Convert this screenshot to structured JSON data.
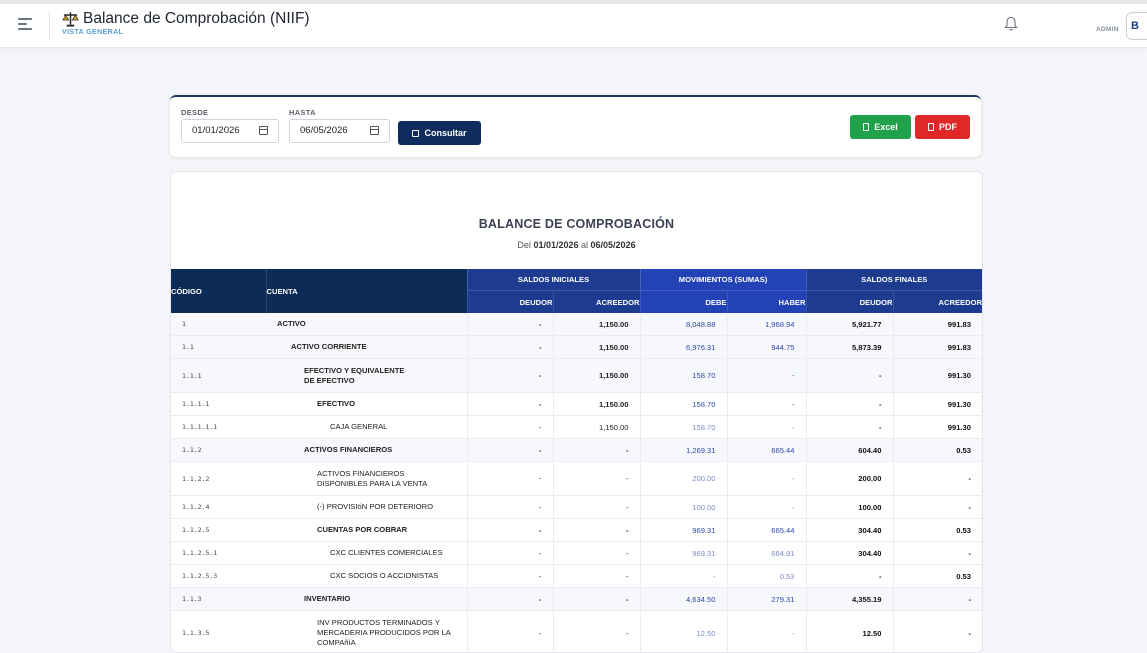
{
  "header": {
    "title": "Balance de Comprobación (NIIF)",
    "subtitle": "VISTA GENERAL",
    "user_role": "ADMIN",
    "avatar_initial": "B"
  },
  "filters": {
    "desde_label": "DESDE",
    "desde_value": "01/01/2026",
    "hasta_label": "HASTA",
    "hasta_value": "06/05/2026",
    "consultar_label": "Consultar",
    "excel_label": "Excel",
    "pdf_label": "PDF"
  },
  "report": {
    "title": "BALANCE DE COMPROBACIÓN",
    "range_prefix": "Del",
    "range_from": "01/01/2026",
    "range_mid": "al",
    "range_to": "06/05/2026",
    "columns": {
      "codigo": "CÓDIGO",
      "cuenta": "CUENTA",
      "saldos_iniciales": "SALDOS INICIALES",
      "movimientos": "MOVIMIENTOS (SUMAS)",
      "saldos_finales": "SALDOS FINALES",
      "deudor": "DEUDOR",
      "acreedor": "ACREEDOR",
      "debe": "DEBE",
      "haber": "HABER"
    },
    "rows": [
      {
        "code": "1",
        "name": "ACTIVO",
        "level": 0,
        "bold": true,
        "si_d": "-",
        "si_a": "1,150.00",
        "debe": "8,048.88",
        "haber": "1,968.94",
        "sf_d": "5,921.77",
        "sf_a": "991.83"
      },
      {
        "code": "1.1",
        "name": "ACTIVO CORRIENTE",
        "level": 1,
        "bold": true,
        "si_d": "-",
        "si_a": "1,150.00",
        "debe": "6,976.31",
        "haber": "944.75",
        "sf_d": "5,873.39",
        "sf_a": "991.83"
      },
      {
        "code": "1.1.1",
        "name": "EFECTIVO Y EQUIVALENTE DE EFECTIVO",
        "level": 2,
        "bold": true,
        "si_d": "-",
        "si_a": "1,150.00",
        "debe": "158.70",
        "haber": "-",
        "sf_d": "-",
        "sf_a": "991.30"
      },
      {
        "code": "1.1.1.1",
        "name": "EFECTIVO",
        "level": 3,
        "bold": true,
        "si_d": "-",
        "si_a": "1,150.00",
        "debe": "158.70",
        "haber": "-",
        "sf_d": "-",
        "sf_a": "991.30"
      },
      {
        "code": "1.1.1.1.1",
        "name": "CAJA GENERAL",
        "level": 4,
        "bold": false,
        "si_d": "-",
        "si_a": "1,150.00",
        "debe": "158.70",
        "haber": "-",
        "sf_d": "-",
        "sf_a": "991.30"
      },
      {
        "code": "1.1.2",
        "name": "ACTIVOS FINANCIEROS",
        "level": 2,
        "bold": true,
        "si_d": "-",
        "si_a": "-",
        "debe": "1,269.31",
        "haber": "665.44",
        "sf_d": "604.40",
        "sf_a": "0.53"
      },
      {
        "code": "1.1.2.2",
        "name": "ACTIVOS FINANCIEROS DISPONIBLES PARA LA VENTA",
        "level": 3,
        "bold": false,
        "si_d": "-",
        "si_a": "-",
        "debe": "200.00",
        "haber": "-",
        "sf_d": "200.00",
        "sf_a": "-"
      },
      {
        "code": "1.1.2.4",
        "name": "(-) PROVISIóN POR DETERIORO",
        "level": 3,
        "bold": false,
        "si_d": "-",
        "si_a": "-",
        "debe": "100.00",
        "haber": "-",
        "sf_d": "100.00",
        "sf_a": "-"
      },
      {
        "code": "1.1.2.5",
        "name": "CUENTAS POR COBRAR",
        "level": 3,
        "bold": true,
        "si_d": "-",
        "si_a": "-",
        "debe": "969.31",
        "haber": "665.44",
        "sf_d": "304.40",
        "sf_a": "0.53"
      },
      {
        "code": "1.1.2.5.1",
        "name": "CXC CLIENTES COMERCIALES",
        "level": 4,
        "bold": false,
        "si_d": "-",
        "si_a": "-",
        "debe": "969.31",
        "haber": "664.91",
        "sf_d": "304.40",
        "sf_a": "-"
      },
      {
        "code": "1.1.2.5.3",
        "name": "CXC SOCIOS O ACCIONISTAS",
        "level": 4,
        "bold": false,
        "si_d": "-",
        "si_a": "-",
        "debe": "-",
        "haber": "0.53",
        "sf_d": "-",
        "sf_a": "0.53"
      },
      {
        "code": "1.1.3",
        "name": "INVENTARIO",
        "level": 2,
        "bold": true,
        "si_d": "-",
        "si_a": "-",
        "debe": "4,634.50",
        "haber": "279.31",
        "sf_d": "4,355.19",
        "sf_a": "-"
      },
      {
        "code": "1.1.3.5",
        "name": "INV PRODUCTOS TERMINADOS Y MERCADERIA PRODUCIDOS POR LA COMPAñíA",
        "level": 3,
        "bold": false,
        "si_d": "-",
        "si_a": "-",
        "debe": "12.50",
        "haber": "-",
        "sf_d": "12.50",
        "sf_a": "-"
      }
    ]
  }
}
